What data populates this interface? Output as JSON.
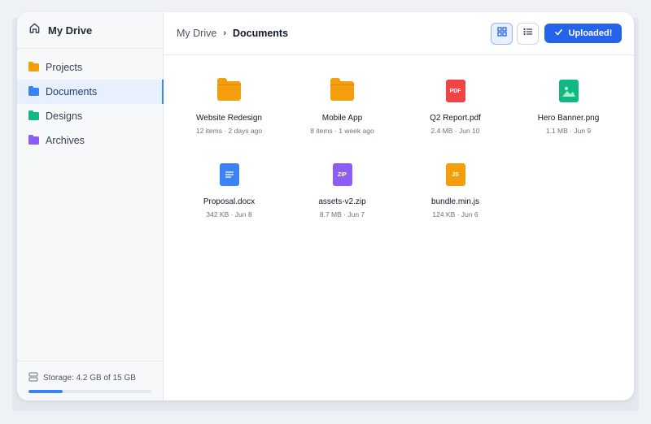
{
  "sidebar": {
    "title": "My Drive",
    "items": [
      {
        "label": "Projects",
        "color": "#f59e0b"
      },
      {
        "label": "Documents",
        "color": "#3b82f6"
      },
      {
        "label": "Designs",
        "color": "#10b981"
      },
      {
        "label": "Archives",
        "color": "#8b5cf6"
      }
    ],
    "storage_label": "Storage: 4.2 GB of 15 GB",
    "storage_used_fraction": 0.28
  },
  "breadcrumb": {
    "root": "My Drive",
    "current": "Documents"
  },
  "toolbar": {
    "upload_label": "Uploaded!"
  },
  "files": [
    {
      "name": "Website Redesign",
      "meta": "12 items · 2 days ago",
      "icon": "folder-icon"
    },
    {
      "name": "Mobile App",
      "meta": "8 items · 1 week ago",
      "icon": "folder-icon"
    },
    {
      "name": "Q2 Report.pdf",
      "meta": "2.4 MB · Jun 10",
      "icon": "pdf-icon",
      "badge": "PDF",
      "color": "#ef4444"
    },
    {
      "name": "Hero Banner.png",
      "meta": "1.1 MB · Jun 9",
      "icon": "image-icon",
      "color": "#10b981"
    },
    {
      "name": "Proposal.docx",
      "meta": "342 KB · Jun 8",
      "icon": "doc-icon",
      "color": "#3b82f6"
    },
    {
      "name": "assets-v2.zip",
      "meta": "8.7 MB · Jun 7",
      "icon": "zip-icon",
      "badge": "ZIP",
      "color": "#8b5cf6"
    },
    {
      "name": "bundle.min.js",
      "meta": "124 KB · Jun 6",
      "icon": "js-icon",
      "badge": "JS",
      "color": "#f59e0b"
    }
  ]
}
